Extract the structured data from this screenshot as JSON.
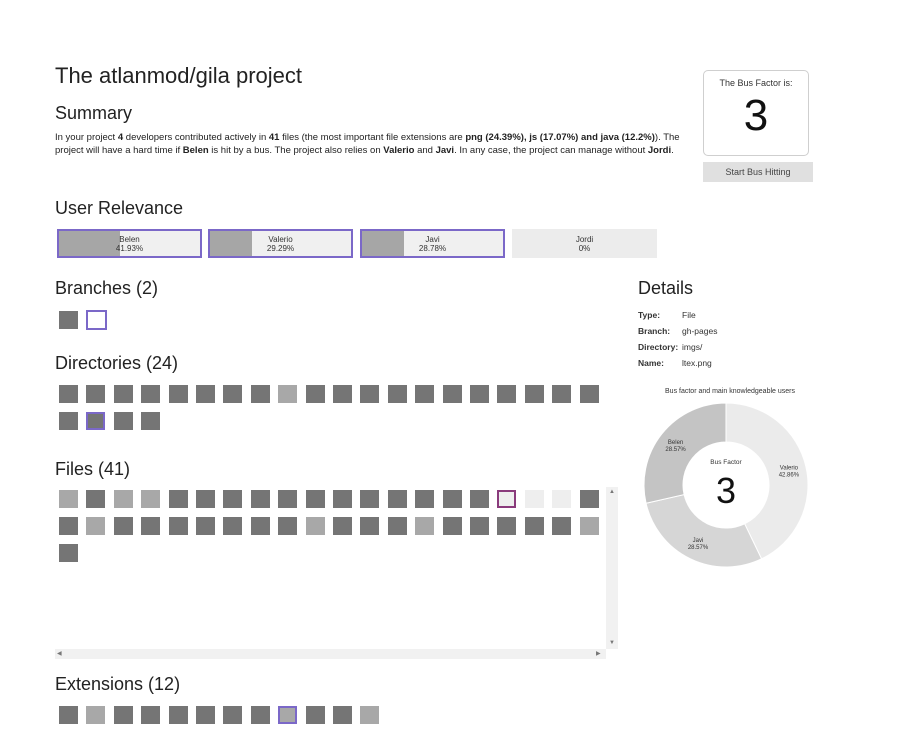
{
  "header": {
    "title": "The atlanmod/gila project",
    "summary_heading": "Summary"
  },
  "summary": {
    "p1": "In your project ",
    "developers": "4",
    "p2": " developers contributed actively in ",
    "files": "41",
    "p3": " files (the most important file extensions are ",
    "ext1": "png (24.39%)",
    "p4": ", ",
    "ext2": "js (17.07%)",
    "p5": " and ",
    "ext3": "java (12.2%)",
    "p6": "). The project will have a hard time if ",
    "critical_user": "Belen",
    "p7": " is hit by a bus. The project also relies on ",
    "user2": "Valerio",
    "p8": " and ",
    "user3": "Javi",
    "p9": ". In any case, the project can manage without ",
    "user4": "Jordi",
    "p10": "."
  },
  "bus_factor": {
    "label": "The Bus Factor is:",
    "value": "3",
    "button": "Start Bus Hitting"
  },
  "user_relevance": {
    "heading": "User Relevance",
    "users": [
      {
        "name": "Belen",
        "pct": "41.93%",
        "fraction": 0.4193,
        "selected": true
      },
      {
        "name": "Valerio",
        "pct": "29.29%",
        "fraction": 0.2929,
        "selected": true
      },
      {
        "name": "Javi",
        "pct": "28.78%",
        "fraction": 0.2878,
        "selected": true
      },
      {
        "name": "Jordi",
        "pct": "0%",
        "fraction": 0,
        "selected": false
      }
    ]
  },
  "branches": {
    "heading": "Branches (2)"
  },
  "directories": {
    "heading": "Directories (24)"
  },
  "files": {
    "heading": "Files (41)"
  },
  "extensions": {
    "heading": "Extensions (12)"
  },
  "details": {
    "heading": "Details",
    "type_label": "Type:",
    "type_value": "File",
    "branch_label": "Branch:",
    "branch_value": "gh-pages",
    "directory_label": "Directory:",
    "directory_value": "imgs/",
    "name_label": "Name:",
    "name_value": "ltex.png"
  },
  "chart_data": {
    "type": "pie",
    "title": "Bus factor and main knowledgeable users",
    "center_label": "Bus Factor",
    "center_value": "3",
    "series": [
      {
        "name": "Valerio",
        "value": 42.86,
        "label": "42.86%",
        "color": "#ebebeb"
      },
      {
        "name": "Javi",
        "value": 28.57,
        "label": "28.57%",
        "color": "#d6d6d6"
      },
      {
        "name": "Belen",
        "value": 28.57,
        "label": "28.57%",
        "color": "#c4c4c4"
      }
    ]
  }
}
